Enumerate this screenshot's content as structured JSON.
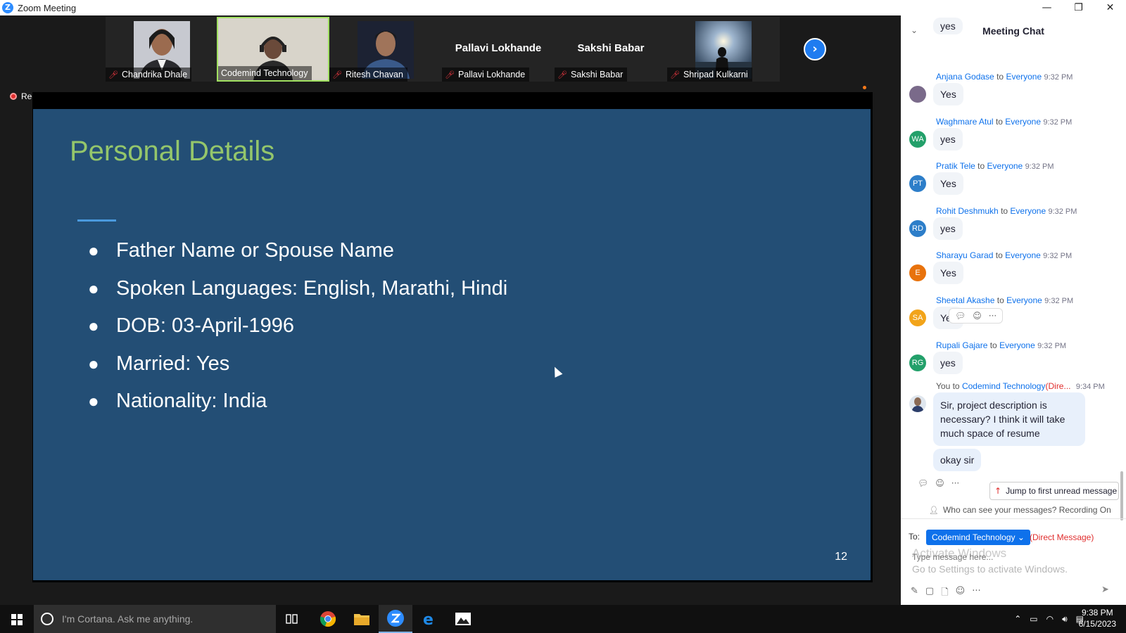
{
  "window": {
    "title": "Zoom Meeting",
    "controls": [
      "—",
      "❐",
      "✕"
    ]
  },
  "gallery": {
    "participants": [
      {
        "name": "Chandrika Dhale",
        "muted": true,
        "has_video": true
      },
      {
        "name": "Codemind Technology",
        "muted": false,
        "has_video": true,
        "active": true
      },
      {
        "name": "Ritesh Chavan",
        "muted": true,
        "has_video": true
      },
      {
        "name": "Pallavi Lokhande",
        "muted": true,
        "has_video": false
      },
      {
        "name": "Sakshi Babar",
        "muted": true,
        "has_video": false
      },
      {
        "name": "Shripad Kulkarni",
        "muted": true,
        "has_video": true
      }
    ],
    "next_icon": "chevron-right-icon"
  },
  "recording": {
    "label": "Recording"
  },
  "slide": {
    "title": "Personal Details",
    "bullets": [
      "Father Name or Spouse Name",
      "Spoken Languages: English, Marathi, Hindi",
      "DOB: 03-April-1996",
      "Married: Yes",
      "Nationality: India"
    ],
    "page_number": "12",
    "colors": {
      "background": "#234e75",
      "title": "#94c66b",
      "accent": "#4a9ade"
    }
  },
  "chat": {
    "title": "Meeting Chat",
    "partial_top": "yes",
    "messages": [
      {
        "sender": "Anjana Godase",
        "to": "to",
        "audience": "Everyone",
        "time": "9:32 PM",
        "text": "Yes",
        "avatar": "",
        "avatar_color": "#7a6a8a"
      },
      {
        "sender": "Waghmare Atul",
        "to": "to",
        "audience": "Everyone",
        "time": "9:32 PM",
        "text": "yes",
        "avatar": "WA",
        "avatar_color": "#23a06a"
      },
      {
        "sender": "Pratik Tele",
        "to": "to",
        "audience": "Everyone",
        "time": "9:32 PM",
        "text": "Yes",
        "avatar": "PT",
        "avatar_color": "#2d7ec9"
      },
      {
        "sender": "Rohit Deshmukh",
        "to": "to",
        "audience": "Everyone",
        "time": "9:32 PM",
        "text": "yes",
        "avatar": "RD",
        "avatar_color": "#2d7ec9"
      },
      {
        "sender": "Sharayu Garad",
        "to": "to",
        "audience": "Everyone",
        "time": "9:32 PM",
        "text": "Yes",
        "avatar": "E",
        "avatar_color": "#e8720c"
      },
      {
        "sender": "Sheetal Akashe",
        "to": "to",
        "audience": "Everyone",
        "time": "9:32 PM",
        "text": "Yes",
        "avatar": "SA",
        "avatar_color": "#f2a41a"
      },
      {
        "sender": "Rupali Gajare",
        "to": "to",
        "audience": "Everyone",
        "time": "9:32 PM",
        "text": "yes",
        "avatar": "RG",
        "avatar_color": "#23a06a"
      }
    ],
    "own_message": {
      "sender": "You",
      "to": "to",
      "recipient": "Codemind Technology",
      "tag": "(Dire...",
      "time": "9:34 PM",
      "text": "Sir, project description is necessary? I think it will take much space of resume",
      "reply": "okay sir"
    },
    "jump_label": "Jump to first unread message",
    "visibility_note": "Who can see your messages? Recording On",
    "compose": {
      "to_label": "To:",
      "recipient": "Codemind Technology",
      "direct_label": "(Direct Message)",
      "placeholder": "Type message here...",
      "watermark_1": "Activate Windows",
      "watermark_2": "Go to Settings to activate Windows."
    }
  },
  "taskbar": {
    "search_placeholder": "I'm Cortana. Ask me anything.",
    "clock_time": "9:38 PM",
    "clock_date": "6/15/2023"
  }
}
